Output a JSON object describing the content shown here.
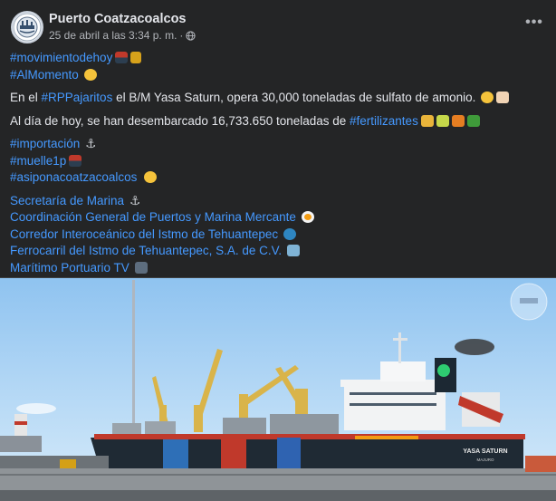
{
  "post": {
    "page_name": "Puerto Coatzacoalcos",
    "timestamp": "25 de abril a las 3:34 p. m.",
    "separator": "·",
    "more_icon": "more-horizontal-icon",
    "globe_icon": "globe-icon"
  },
  "content": {
    "tag_movimiento": "#movimientodehoy",
    "tag_almomento": "#AlMomento",
    "p1_before": "En el ",
    "p1_tag": "#RPPajaritos",
    "p1_after": " el B/M Yasa Saturn, opera 30,000 toneladas de sulfato de amonio.",
    "p2_before": "Al día de hoy, se han desembarcado 16,733.650 toneladas de ",
    "p2_tag": "#fertilizantes",
    "tag_importacion": "#importación",
    "tag_muelle": "#muelle1p",
    "tag_asipona": "#asiponacoatzacoalcos",
    "link_semar": "Secretaría de Marina",
    "link_coordinacion": "Coordinación General de Puertos y Marina Mercante",
    "link_corredor": "Corredor Interoceánico del Istmo de Tehuantepec",
    "link_ferrocarril": "Ferrocarril del Istmo de Tehuantepec, S.A. de C.V.",
    "link_maritimo": "Marítimo Portuario TV"
  },
  "photo": {
    "ship_name": "YASA SATURN",
    "ship_port": "MAJURO",
    "description_icon": "ship-photo"
  },
  "colors": {
    "background": "#242526",
    "text": "#e4e6eb",
    "secondary": "#b0b3b8",
    "link": "#4599ff"
  }
}
